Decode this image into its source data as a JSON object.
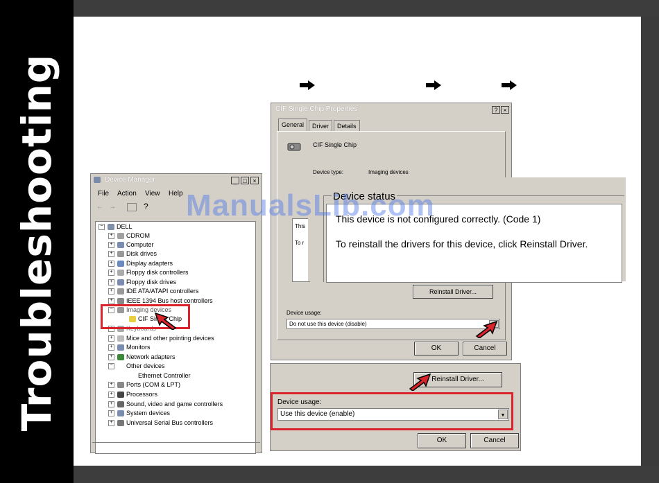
{
  "sidebar": {
    "title": "Troubleshooting"
  },
  "device_manager": {
    "title": "Device Manager",
    "menu": [
      "File",
      "Action",
      "View",
      "Help"
    ],
    "root": "DELL",
    "tree": [
      "CDROM",
      "Computer",
      "Disk drives",
      "Display adapters",
      "Floppy disk controllers",
      "Floppy disk drives",
      "IDE ATA/ATAPI controllers",
      "IEEE 1394 Bus host controllers",
      "Imaging devices",
      "CIF Single Chip",
      "Keyboards",
      "Mice and other pointing devices",
      "Monitors",
      "Network adapters",
      "Other devices",
      "Ethernet Controller",
      "Ports (COM & LPT)",
      "Processors",
      "Sound, video and game controllers",
      "System devices",
      "Universal Serial Bus controllers"
    ]
  },
  "properties": {
    "title": "CIF Single Chip  Properties",
    "tabs": [
      "General",
      "Driver",
      "Details"
    ],
    "device_name": "CIF Single Chip",
    "device_type_label": "Device type:",
    "device_type_value": "Imaging devices",
    "reinstall_label": "Reinstall Driver...",
    "device_usage_label": "Device usage:",
    "device_usage_value": "Do not use this device (disable)",
    "ok_label": "OK",
    "cancel_label": "Cancel",
    "status_frag_1": "This",
    "status_frag_2": "To r"
  },
  "zoom_status": {
    "heading": "Device status",
    "line1": "This device is not configured correctly. (Code 1)",
    "line2": "To reinstall the drivers for this device, click Reinstall Driver."
  },
  "enable_panel": {
    "reinstall_label": "Reinstall Driver...",
    "device_usage_label": "Device usage:",
    "device_usage_value": "Use this device (enable)",
    "ok_label": "OK",
    "cancel_label": "Cancel"
  },
  "watermark": "ManualsLib.com",
  "colors": {
    "highlight_red": "#d9242b",
    "sidebar_bg": "#000000"
  }
}
